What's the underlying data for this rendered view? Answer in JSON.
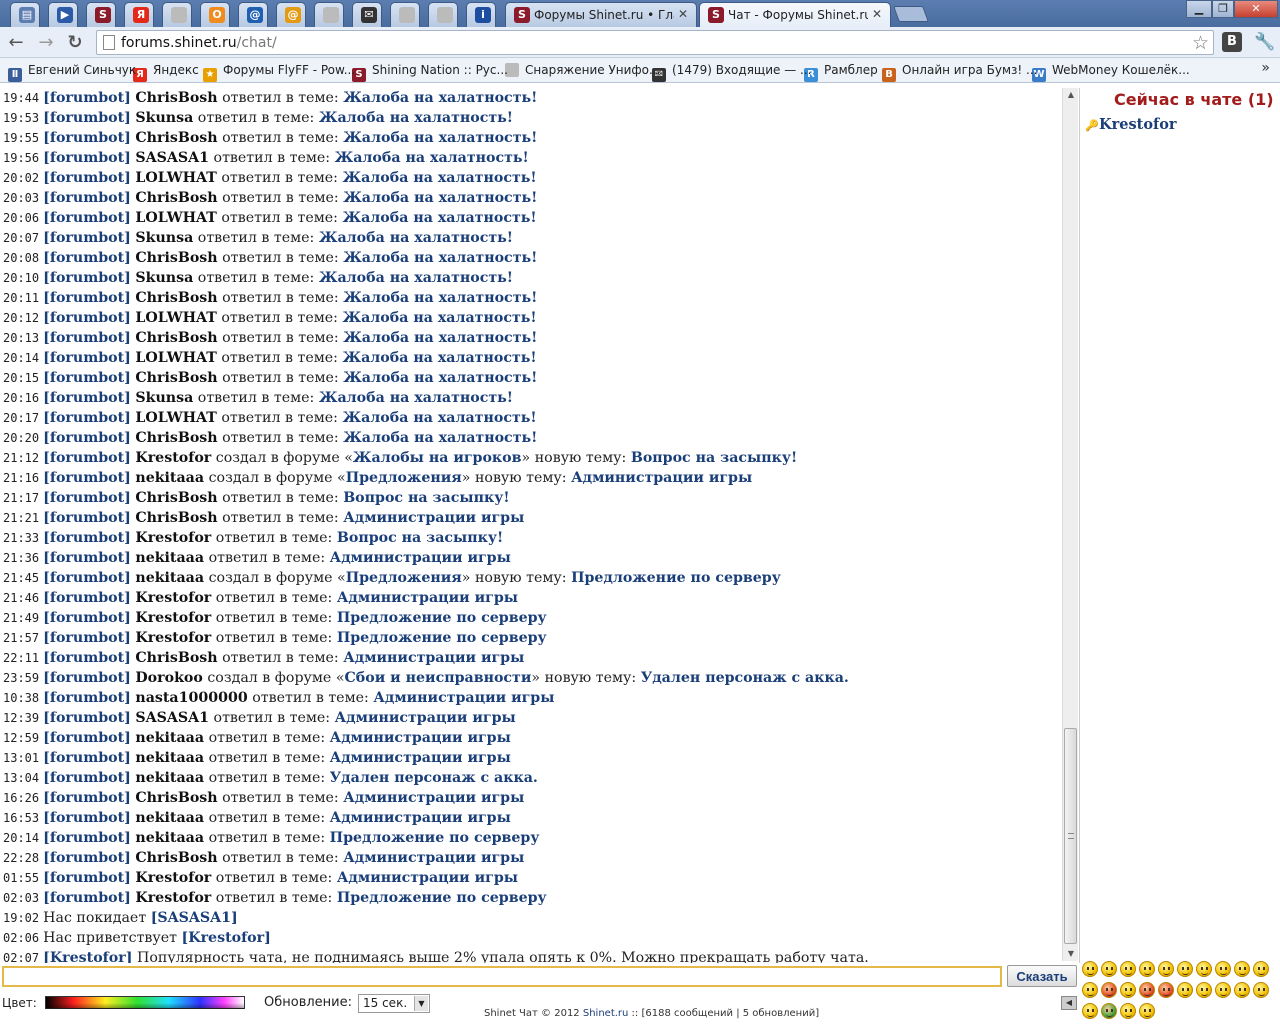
{
  "browser": {
    "tabs": [
      {
        "label": "",
        "icon": "chat-icon",
        "color": "#5c7db0"
      },
      {
        "label": "",
        "icon": "play-icon",
        "color": "#2b5aa7"
      },
      {
        "label": "",
        "icon": "shinet-icon",
        "color": "#8b1a2a"
      },
      {
        "label": "",
        "icon": "yandex-icon",
        "color": "#e4281a"
      },
      {
        "label": "",
        "icon": "page-icon",
        "color": "#bbbbbb"
      },
      {
        "label": "",
        "icon": "odnoklassniki-icon",
        "color": "#f08c1e"
      },
      {
        "label": "",
        "icon": "mail-at-icon",
        "color": "#1e5fb4"
      },
      {
        "label": "",
        "icon": "mail-at-orange-icon",
        "color": "#e59a14"
      },
      {
        "label": "",
        "icon": "page-icon",
        "color": "#bbbbbb"
      },
      {
        "label": "",
        "icon": "envelope-icon",
        "color": "#333333"
      },
      {
        "label": "",
        "icon": "page-icon",
        "color": "#bbbbbb"
      },
      {
        "label": "",
        "icon": "page-icon",
        "color": "#bbbbbb"
      },
      {
        "label": "",
        "icon": "info-icon",
        "color": "#1d4ea0"
      },
      {
        "label": "Форумы Shinet.ru • Главна",
        "icon": "shinet-icon",
        "color": "#8b1a2a"
      },
      {
        "label": "Чат - Форумы Shinet.ru",
        "icon": "shinet-icon",
        "color": "#8b1a2a"
      }
    ],
    "url_host": "forums.shinet.ru",
    "url_path": "/chat/",
    "ext_label": "В",
    "bookmarks": [
      {
        "label": "Евгений Синьчук",
        "icon": "pause-icon",
        "color": "#3a5e99"
      },
      {
        "label": "Яндекс",
        "icon": "yandex-icon",
        "color": "#e4281a"
      },
      {
        "label": "Форумы FlyFF - Pow...",
        "icon": "star-icon",
        "color": "#e8a000"
      },
      {
        "label": "Shining Nation :: Рус...",
        "icon": "shinet-icon",
        "color": "#8b1a2a"
      },
      {
        "label": "Снаряжение Унифо...",
        "icon": "page-icon",
        "color": "#bbbbbb"
      },
      {
        "label": "(1479) Входящие — ...",
        "icon": "envelope-icon",
        "color": "#333333"
      },
      {
        "label": "Рамблер",
        "icon": "rambler-icon",
        "color": "#3b8fd6"
      },
      {
        "label": "Онлайн игра Бумз! ...",
        "icon": "boomz-icon",
        "color": "#c8641e"
      },
      {
        "label": "WebMoney Кошелёк...",
        "icon": "globe-icon",
        "color": "#3a7cc8"
      }
    ]
  },
  "chat": {
    "messages": [
      {
        "time": "19:44",
        "bot": "[forumbot]",
        "user": "ChrisBosh",
        "action": "ответил в теме:",
        "topic": "Жалоба на халатность!"
      },
      {
        "time": "19:53",
        "bot": "[forumbot]",
        "user": "Skunsa",
        "action": "ответил в теме:",
        "topic": "Жалоба на халатность!"
      },
      {
        "time": "19:55",
        "bot": "[forumbot]",
        "user": "ChrisBosh",
        "action": "ответил в теме:",
        "topic": "Жалоба на халатность!"
      },
      {
        "time": "19:56",
        "bot": "[forumbot]",
        "user": "SASASA1",
        "action": "ответил в теме:",
        "topic": "Жалоба на халатность!"
      },
      {
        "time": "20:02",
        "bot": "[forumbot]",
        "user": "LOLWHAT",
        "action": "ответил в теме:",
        "topic": "Жалоба на халатность!"
      },
      {
        "time": "20:03",
        "bot": "[forumbot]",
        "user": "ChrisBosh",
        "action": "ответил в теме:",
        "topic": "Жалоба на халатность!"
      },
      {
        "time": "20:06",
        "bot": "[forumbot]",
        "user": "LOLWHAT",
        "action": "ответил в теме:",
        "topic": "Жалоба на халатность!"
      },
      {
        "time": "20:07",
        "bot": "[forumbot]",
        "user": "Skunsa",
        "action": "ответил в теме:",
        "topic": "Жалоба на халатность!"
      },
      {
        "time": "20:08",
        "bot": "[forumbot]",
        "user": "ChrisBosh",
        "action": "ответил в теме:",
        "topic": "Жалоба на халатность!"
      },
      {
        "time": "20:10",
        "bot": "[forumbot]",
        "user": "Skunsa",
        "action": "ответил в теме:",
        "topic": "Жалоба на халатность!"
      },
      {
        "time": "20:11",
        "bot": "[forumbot]",
        "user": "ChrisBosh",
        "action": "ответил в теме:",
        "topic": "Жалоба на халатность!"
      },
      {
        "time": "20:12",
        "bot": "[forumbot]",
        "user": "LOLWHAT",
        "action": "ответил в теме:",
        "topic": "Жалоба на халатность!"
      },
      {
        "time": "20:13",
        "bot": "[forumbot]",
        "user": "ChrisBosh",
        "action": "ответил в теме:",
        "topic": "Жалоба на халатность!"
      },
      {
        "time": "20:14",
        "bot": "[forumbot]",
        "user": "LOLWHAT",
        "action": "ответил в теме:",
        "topic": "Жалоба на халатность!"
      },
      {
        "time": "20:15",
        "bot": "[forumbot]",
        "user": "ChrisBosh",
        "action": "ответил в теме:",
        "topic": "Жалоба на халатность!"
      },
      {
        "time": "20:16",
        "bot": "[forumbot]",
        "user": "Skunsa",
        "action": "ответил в теме:",
        "topic": "Жалоба на халатность!"
      },
      {
        "time": "20:17",
        "bot": "[forumbot]",
        "user": "LOLWHAT",
        "action": "ответил в теме:",
        "topic": "Жалоба на халатность!"
      },
      {
        "time": "20:20",
        "bot": "[forumbot]",
        "user": "ChrisBosh",
        "action": "ответил в теме:",
        "topic": "Жалоба на халатность!"
      },
      {
        "time": "21:12",
        "bot": "[forumbot]",
        "user": "Krestofor",
        "action": "создал в форуме «",
        "forum": "Жалобы на игроков",
        "action2": "» новую тему:",
        "topic": "Вопрос на засыпку!"
      },
      {
        "time": "21:16",
        "bot": "[forumbot]",
        "user": "nekitaaa",
        "action": "создал в форуме «",
        "forum": "Предложения",
        "action2": "» новую тему:",
        "topic": "Администрации игры"
      },
      {
        "time": "21:17",
        "bot": "[forumbot]",
        "user": "ChrisBosh",
        "action": "ответил в теме:",
        "topic": "Вопрос на засыпку!"
      },
      {
        "time": "21:21",
        "bot": "[forumbot]",
        "user": "ChrisBosh",
        "action": "ответил в теме:",
        "topic": "Администрации игры"
      },
      {
        "time": "21:33",
        "bot": "[forumbot]",
        "user": "Krestofor",
        "action": "ответил в теме:",
        "topic": "Вопрос на засыпку!"
      },
      {
        "time": "21:36",
        "bot": "[forumbot]",
        "user": "nekitaaa",
        "action": "ответил в теме:",
        "topic": "Администрации игры"
      },
      {
        "time": "21:45",
        "bot": "[forumbot]",
        "user": "nekitaaa",
        "action": "создал в форуме «",
        "forum": "Предложения",
        "action2": "» новую тему:",
        "topic": "Предложение по серверу"
      },
      {
        "time": "21:46",
        "bot": "[forumbot]",
        "user": "Krestofor",
        "action": "ответил в теме:",
        "topic": "Администрации игры"
      },
      {
        "time": "21:49",
        "bot": "[forumbot]",
        "user": "Krestofor",
        "action": "ответил в теме:",
        "topic": "Предложение по серверу"
      },
      {
        "time": "21:57",
        "bot": "[forumbot]",
        "user": "Krestofor",
        "action": "ответил в теме:",
        "topic": "Предложение по серверу"
      },
      {
        "time": "22:11",
        "bot": "[forumbot]",
        "user": "ChrisBosh",
        "action": "ответил в теме:",
        "topic": "Администрации игры"
      },
      {
        "time": "23:59",
        "bot": "[forumbot]",
        "user": "Dorokoo",
        "action": "создал в форуме «",
        "forum": "Сбои и неисправности",
        "action2": "» новую тему:",
        "topic": "Удален персонаж с акка."
      },
      {
        "time": "10:38",
        "bot": "[forumbot]",
        "user": "nasta1000000",
        "action": "ответил в теме:",
        "topic": "Администрации игры"
      },
      {
        "time": "12:39",
        "bot": "[forumbot]",
        "user": "SASASA1",
        "action": "ответил в теме:",
        "topic": "Администрации игры"
      },
      {
        "time": "12:59",
        "bot": "[forumbot]",
        "user": "nekitaaa",
        "action": "ответил в теме:",
        "topic": "Администрации игры"
      },
      {
        "time": "13:01",
        "bot": "[forumbot]",
        "user": "nekitaaa",
        "action": "ответил в теме:",
        "topic": "Администрации игры"
      },
      {
        "time": "13:04",
        "bot": "[forumbot]",
        "user": "nekitaaa",
        "action": "ответил в теме:",
        "topic": "Удален персонаж с акка."
      },
      {
        "time": "16:26",
        "bot": "[forumbot]",
        "user": "ChrisBosh",
        "action": "ответил в теме:",
        "topic": "Администрации игры"
      },
      {
        "time": "16:53",
        "bot": "[forumbot]",
        "user": "nekitaaa",
        "action": "ответил в теме:",
        "topic": "Администрации игры"
      },
      {
        "time": "20:14",
        "bot": "[forumbot]",
        "user": "nekitaaa",
        "action": "ответил в теме:",
        "topic": "Предложение по серверу"
      },
      {
        "time": "22:28",
        "bot": "[forumbot]",
        "user": "ChrisBosh",
        "action": "ответил в теме:",
        "topic": "Администрации игры"
      },
      {
        "time": "01:55",
        "bot": "[forumbot]",
        "user": "Krestofor",
        "action": "ответил в теме:",
        "topic": "Администрации игры"
      },
      {
        "time": "02:03",
        "bot": "[forumbot]",
        "user": "Krestofor",
        "action": "ответил в теме:",
        "topic": "Предложение по серверу"
      },
      {
        "time": "19:02",
        "plain": "Нас покидает",
        "name": "[SASASA1]"
      },
      {
        "time": "02:06",
        "plain": "Нас приветствует",
        "name": "[Krestofor]"
      },
      {
        "time": "02:07",
        "speaker": "[Krestofor]",
        "text": "Популярность чата, не поднимаясь выше 2% упала опять к 0%. Можно прекращать работу чата."
      }
    ]
  },
  "sidebar": {
    "title": "Сейчас в чате (1)",
    "users": [
      "Krestofor"
    ]
  },
  "bottom": {
    "send_label": "Сказать",
    "color_label": "Цвет:",
    "refresh_label": "Обновление:",
    "refresh_value": "15 сек.",
    "footer_prefix": "Shinet Чат © 2012 ",
    "footer_site": "Shinet.ru",
    "footer_suffix": " :: [6188 сообщений | 5 обновлений]"
  },
  "colors": {
    "link": "#1a3e78",
    "sidebar_title": "#a21c1c",
    "input_border": "#e5b84a"
  }
}
